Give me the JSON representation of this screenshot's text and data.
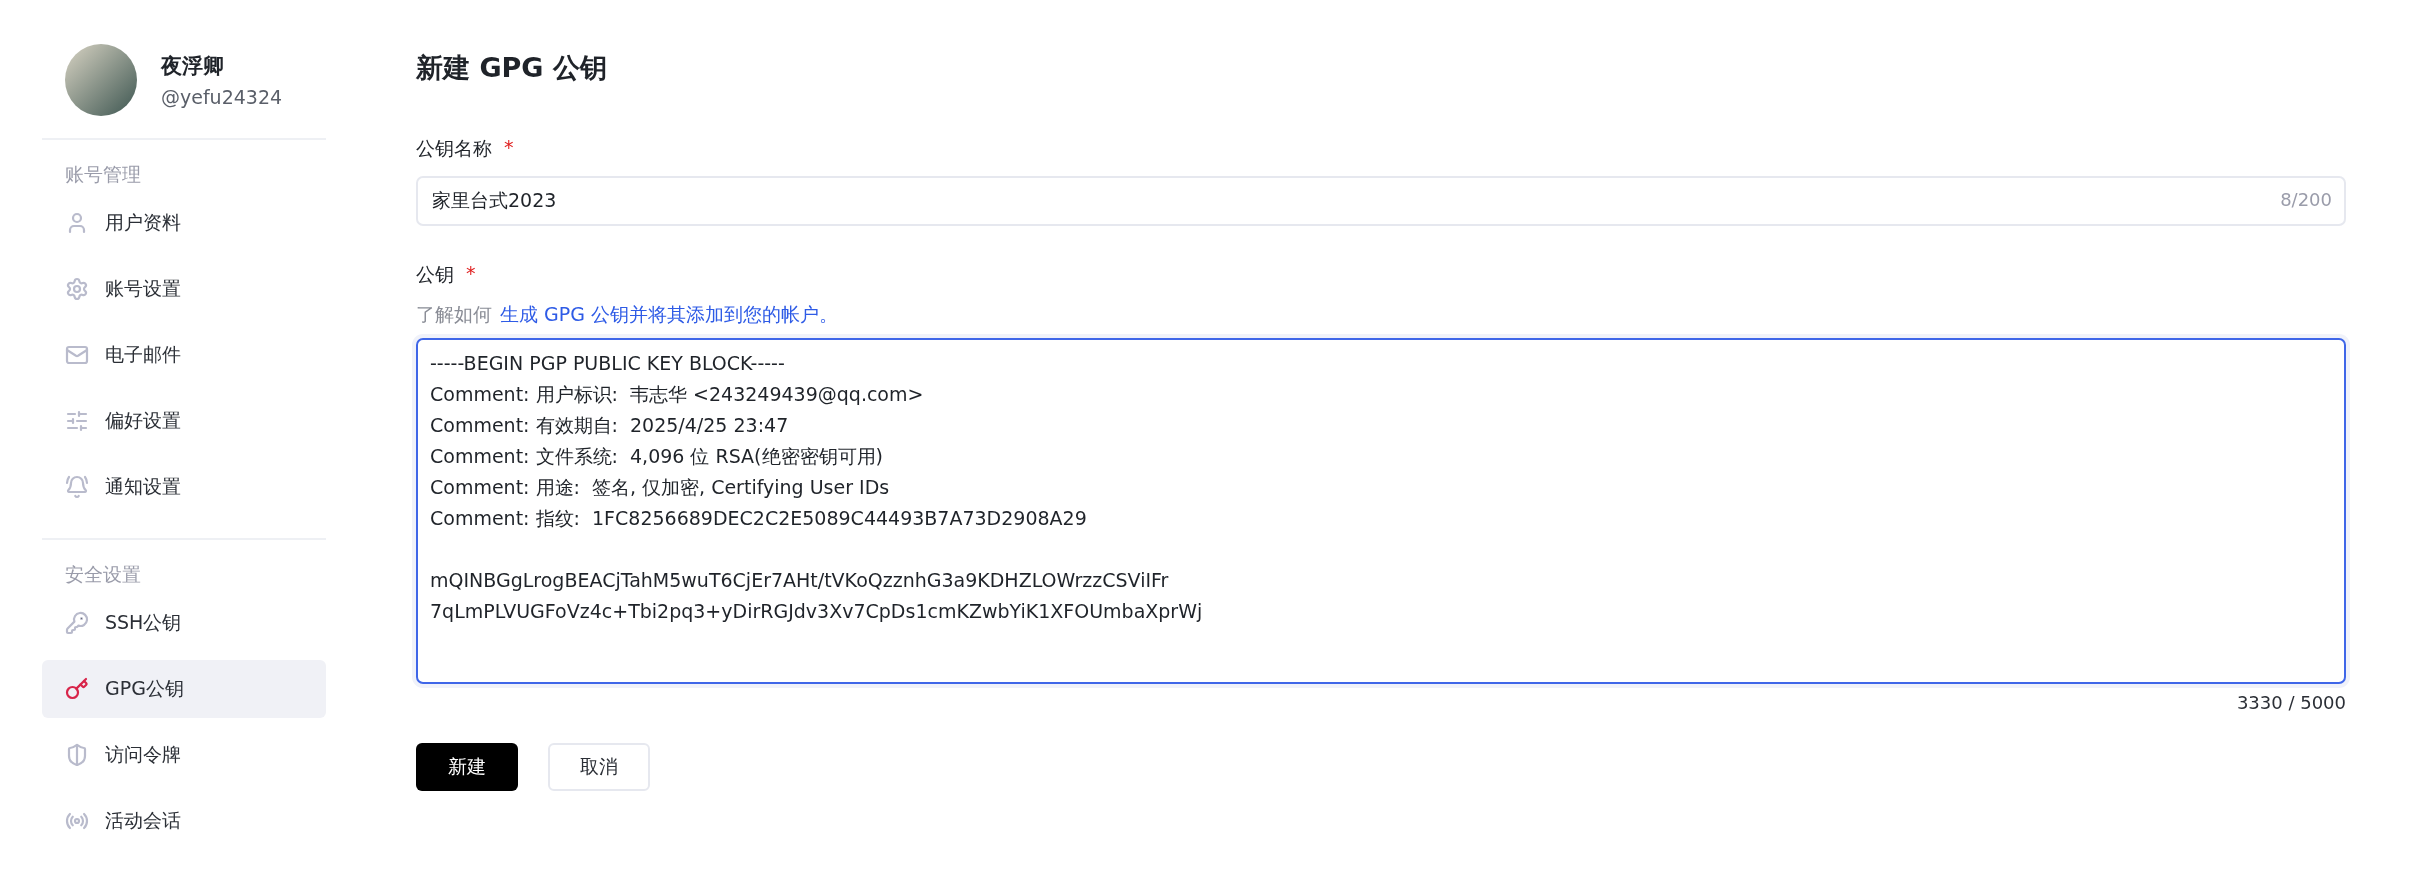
{
  "user": {
    "name": "夜浮卿",
    "handle": "@yefu24324"
  },
  "sidebar": {
    "sections": [
      {
        "title": "账号管理",
        "items": [
          {
            "label": "用户资料",
            "selected": false
          },
          {
            "label": "账号设置",
            "selected": false
          },
          {
            "label": "电子邮件",
            "selected": false
          },
          {
            "label": "偏好设置",
            "selected": false
          },
          {
            "label": "通知设置",
            "selected": false
          }
        ]
      },
      {
        "title": "安全设置",
        "items": [
          {
            "label": "SSH公钥",
            "selected": false
          },
          {
            "label": "GPG公钥",
            "selected": true
          },
          {
            "label": "访问令牌",
            "selected": false
          },
          {
            "label": "活动会话",
            "selected": false
          }
        ]
      }
    ]
  },
  "page_title": "新建 GPG 公钥",
  "name_field": {
    "label": "公钥名称",
    "required_mark": "*",
    "value": "家里台式2023",
    "counter": "8/200"
  },
  "key_field": {
    "label": "公钥",
    "required_mark": "*",
    "hint_prefix": "了解如何",
    "hint_link": "生成 GPG 公钥并将其添加到您的帐户。",
    "value": "-----BEGIN PGP PUBLIC KEY BLOCK-----\nComment: 用户标识:  韦志华 <243249439@qq.com>\nComment: 有效期自:  2025/4/25 23:47\nComment: 文件系统:  4,096 位 RSA(绝密密钥可用)\nComment: 用途:  签名, 仅加密, Certifying User IDs\nComment: 指纹:  1FC8256689DEC2C2E5089C44493B7A73D2908A29\n\nmQINBGgLrogBEACjTahM5wuT6CjEr7AHt/tVKoQzznhG3a9KDHZLOWrzzCSViIFr\n7qLmPLVUGFoVz4c+Tbi2pq3+yDirRGJdv3Xv7CpDs1cmKZwbYiK1XFOUmbaXprWj",
    "counter": "3330 / 5000"
  },
  "buttons": [
    {
      "label": "新建",
      "kind": "primary"
    },
    {
      "label": "取消",
      "kind": "secondary"
    }
  ]
}
